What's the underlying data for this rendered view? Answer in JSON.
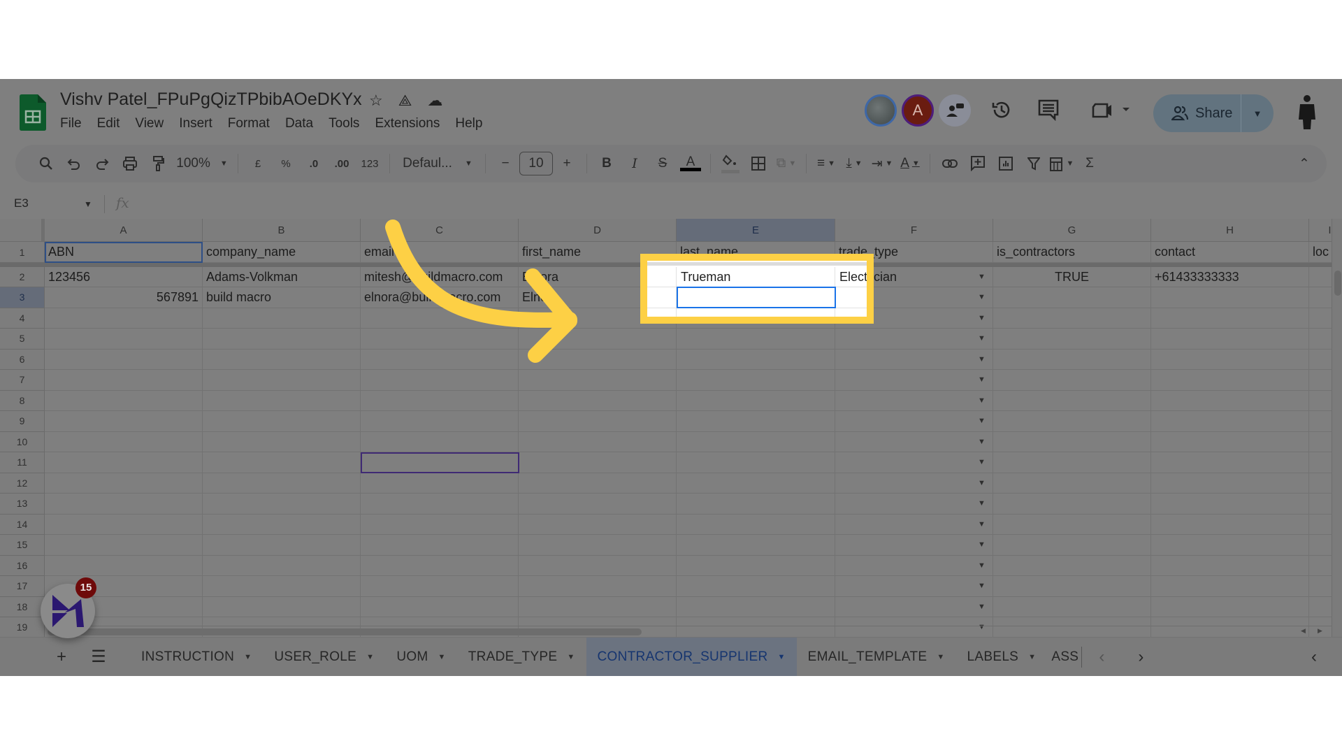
{
  "document": {
    "title": "Vishv Patel_FPuPgQizTPbibAOeDKYx",
    "title_icons": [
      "star-icon",
      "move-to-drive-icon",
      "cloud-saved-icon"
    ]
  },
  "menu": [
    "File",
    "Edit",
    "View",
    "Insert",
    "Format",
    "Data",
    "Tools",
    "Extensions",
    "Help"
  ],
  "header_right": {
    "collaborator_initial": "A",
    "share_label": "Share"
  },
  "toolbar": {
    "zoom": "100%",
    "currency": "£",
    "percent": "%",
    "decrease_decimal": ".0",
    "increase_decimal": ".00",
    "number_format": "123",
    "font": "Defaul...",
    "font_size": "10",
    "bold": "B",
    "italic": "I",
    "text_color": "A",
    "text_rotation": "A",
    "sum": "Σ"
  },
  "formula_bar": {
    "name_box": "E3",
    "fx": "fx",
    "value": ""
  },
  "grid": {
    "columns": [
      "A",
      "B",
      "C",
      "D",
      "E",
      "F",
      "G",
      "H",
      "I"
    ],
    "selected_column": "E",
    "selected_row": "3",
    "active_cell": "E3",
    "rows": [
      "1",
      "2",
      "3",
      "4",
      "5",
      "6",
      "7",
      "8",
      "9",
      "10",
      "11",
      "12",
      "13",
      "14",
      "15",
      "16",
      "17",
      "18",
      "19"
    ],
    "header_row": [
      "ABN",
      "company_name",
      "email",
      "first_name",
      "last_name",
      "trade_type",
      "is_contractors",
      "contact",
      "loc"
    ],
    "data": [
      [
        "123456",
        "Adams-Volkman",
        "mitesh@buildmacro.com",
        "Elnora",
        "Trueman",
        "Electrician",
        "TRUE",
        "+61433333333",
        ""
      ],
      [
        "567891",
        "build macro",
        "elnora@buildmacro.com",
        "Elnora",
        "",
        "",
        "",
        "",
        ""
      ]
    ]
  },
  "sheet_tabs": {
    "tabs": [
      "INSTRUCTION",
      "USER_ROLE",
      "UOM",
      "TRADE_TYPE",
      "CONTRACTOR_SUPPLIER",
      "EMAIL_TEMPLATE",
      "LABELS",
      "ASS"
    ],
    "active": "CONTRACTOR_SUPPLIER"
  },
  "floating_widget": {
    "notification_count": "15"
  },
  "annotation": {
    "highlight_color": "#fdd045",
    "target_cell": "E3"
  }
}
